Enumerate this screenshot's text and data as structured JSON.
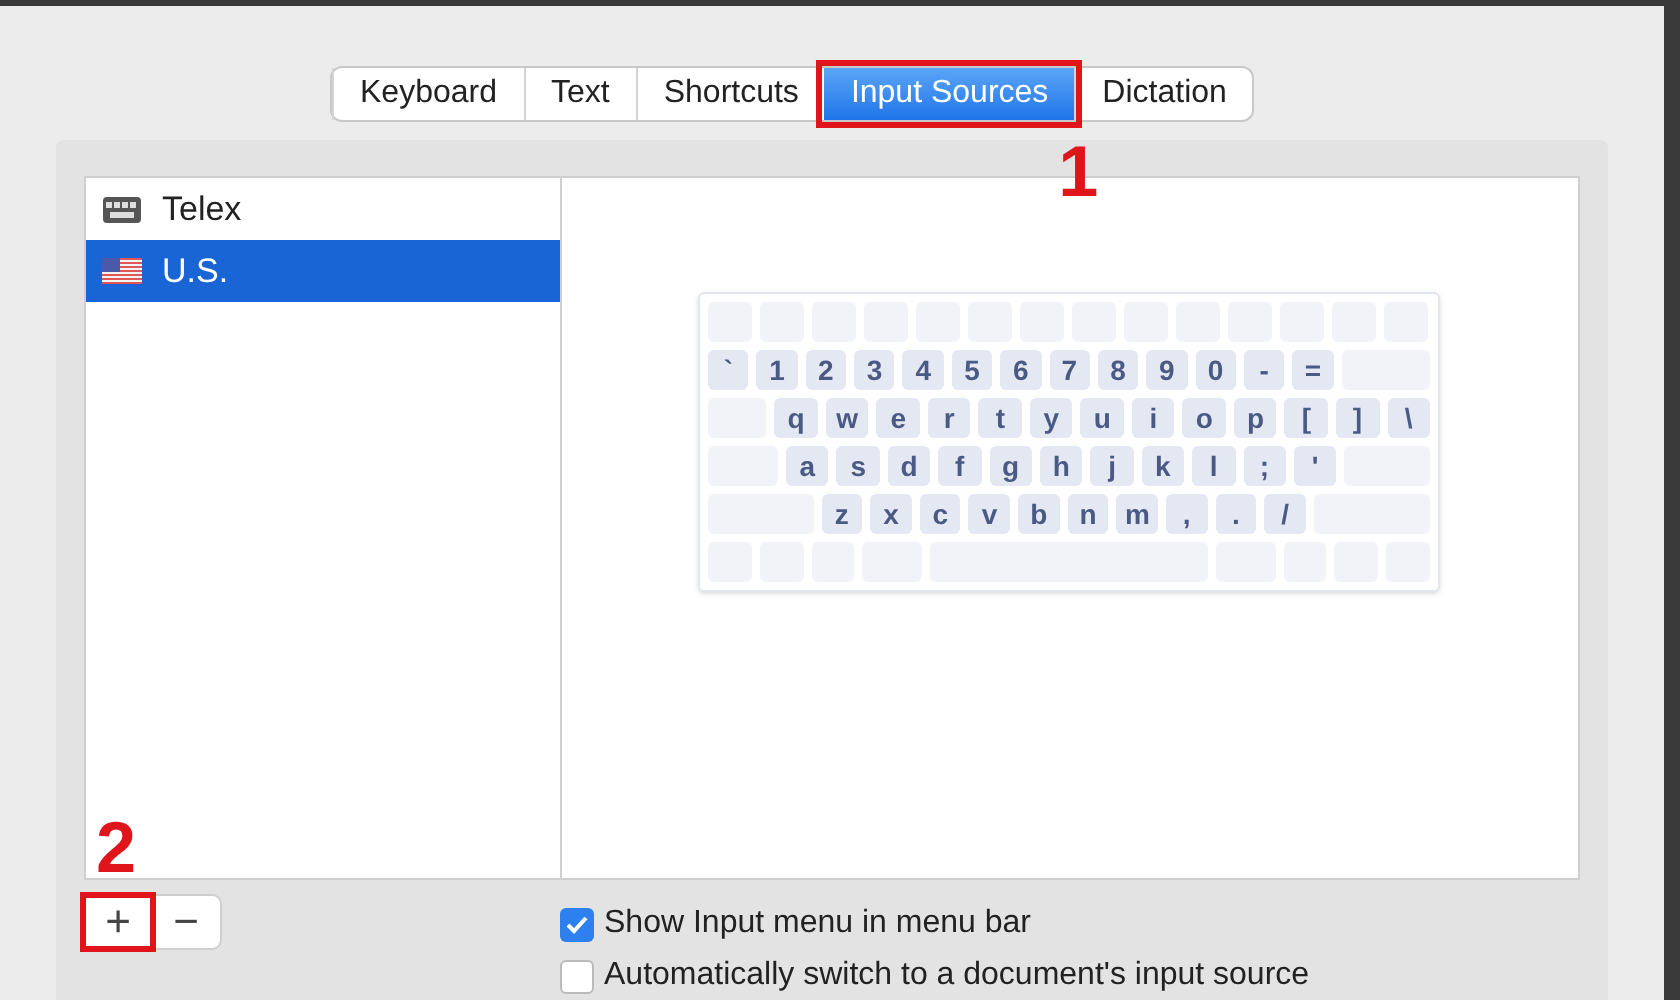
{
  "tabs": [
    {
      "label": "Keyboard",
      "selected": false,
      "annotated": false
    },
    {
      "label": "Text",
      "selected": false,
      "annotated": false
    },
    {
      "label": "Shortcuts",
      "selected": false,
      "annotated": false
    },
    {
      "label": "Input Sources",
      "selected": true,
      "annotated": true
    },
    {
      "label": "Dictation",
      "selected": false,
      "annotated": false
    }
  ],
  "annotations": [
    {
      "label": "1"
    },
    {
      "label": "2"
    }
  ],
  "sources": [
    {
      "label": "Telex",
      "kind": "keyboard",
      "selected": false
    },
    {
      "label": "U.S.",
      "kind": "flag",
      "selected": true
    }
  ],
  "keyboard": {
    "rows": [
      {
        "keys": [
          "`",
          "1",
          "2",
          "3",
          "4",
          "5",
          "6",
          "7",
          "8",
          "9",
          "0",
          "-",
          "="
        ]
      },
      {
        "keys": [
          "q",
          "w",
          "e",
          "r",
          "t",
          "y",
          "u",
          "i",
          "o",
          "p",
          "[",
          "]",
          "\\"
        ]
      },
      {
        "keys": [
          "a",
          "s",
          "d",
          "f",
          "g",
          "h",
          "j",
          "k",
          "l",
          ";",
          "'"
        ]
      },
      {
        "keys": [
          "z",
          "x",
          "c",
          "v",
          "b",
          "n",
          "m",
          ",",
          ".",
          "/"
        ]
      }
    ]
  },
  "buttons": [
    {
      "label": "+",
      "annotated": true
    },
    {
      "label": "−",
      "annotated": false
    }
  ],
  "options": [
    {
      "label": "Show Input menu in menu bar",
      "checked": true
    },
    {
      "label": "Automatically switch to a document's input source",
      "checked": false
    }
  ]
}
